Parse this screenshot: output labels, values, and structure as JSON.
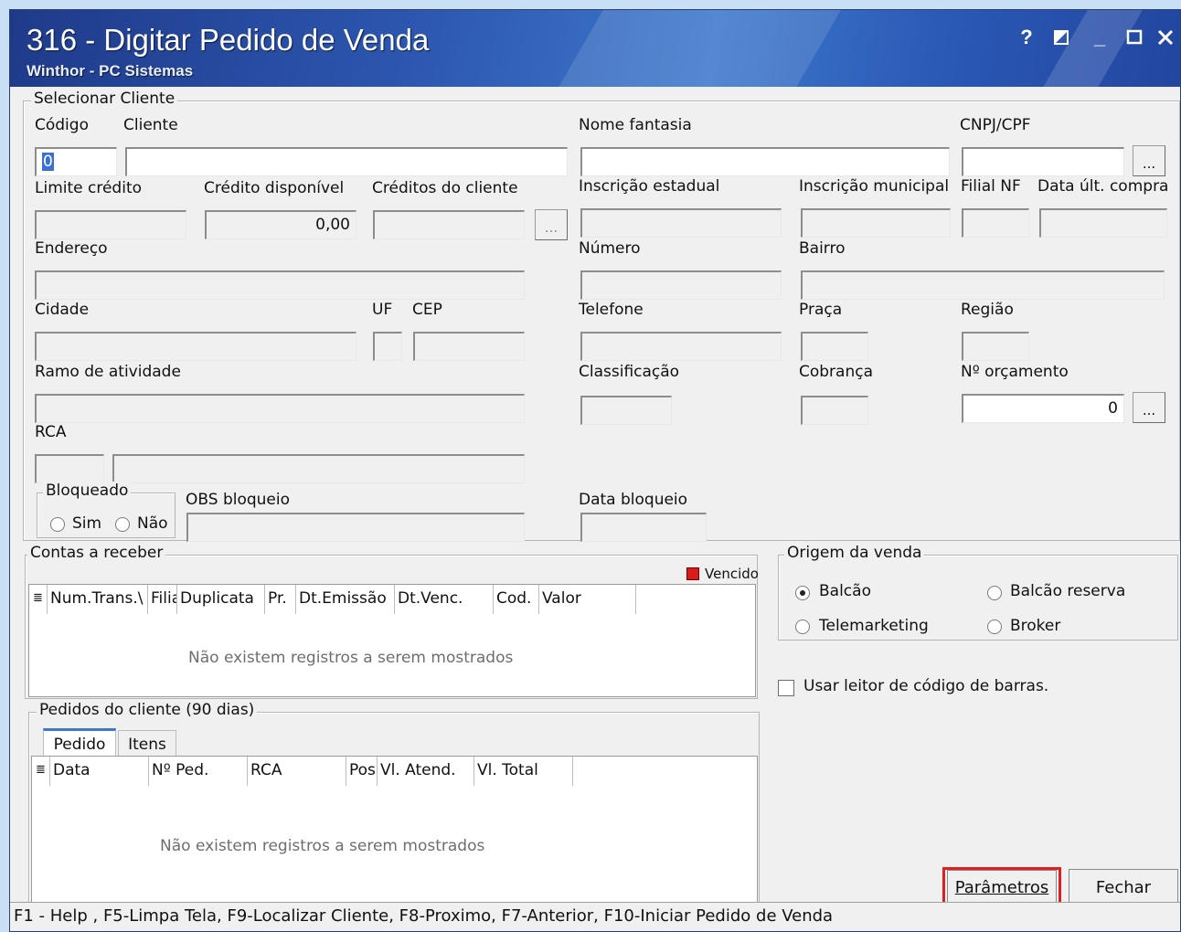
{
  "window": {
    "title": "316 - Digitar Pedido de Venda",
    "subtitle": "Winthor - PC Sistemas",
    "controls": {
      "help": "?",
      "restore": "◩",
      "minimize": "_",
      "maximize": "□",
      "close": "✕"
    }
  },
  "cliente": {
    "group_title": "Selecionar Cliente",
    "codigo_label": "Código",
    "codigo_value": "0",
    "cliente_label": "Cliente",
    "nome_fantasia_label": "Nome fantasia",
    "cnpj_label": "CNPJ/CPF",
    "limite_label": "Limite crédito",
    "credito_disp_label": "Crédito disponível",
    "credito_disp_value": "0,00",
    "creditos_cliente_label": "Créditos do cliente",
    "insc_estadual_label": "Inscrição estadual",
    "insc_municipal_label": "Inscrição municipal",
    "filial_nf_label": "Filial NF",
    "data_ult_compra_label": "Data últ. compra",
    "endereco_label": "Endereço",
    "numero_label": "Número",
    "bairro_label": "Bairro",
    "cidade_label": "Cidade",
    "uf_label": "UF",
    "cep_label": "CEP",
    "telefone_label": "Telefone",
    "praca_label": "Praça",
    "regiao_label": "Região",
    "ramo_label": "Ramo de atividade",
    "classificacao_label": "Classificação",
    "cobranca_label": "Cobrança",
    "orcamento_label": "Nº orçamento",
    "orcamento_value": "0",
    "rca_label": "RCA",
    "bloqueado_title": "Bloqueado",
    "sim_label": "Sim",
    "nao_label": "Não",
    "obs_bloqueio_label": "OBS bloqueio",
    "data_bloqueio_label": "Data bloqueio",
    "browse_label": "..."
  },
  "contas": {
    "title": "Contas a receber",
    "vencido_label": "Vencido",
    "vencido_color": "#d81c1c",
    "columns": [
      "Num.Trans.\\",
      "Filia",
      "Duplicata",
      "Pr.",
      "Dt.Emissão",
      "Dt.Venc.",
      "Cod.",
      "Valor"
    ],
    "empty": "Não existem registros a serem mostrados"
  },
  "pedidos": {
    "title": "Pedidos do cliente (90 dias)",
    "tabs": [
      "Pedido",
      "Itens"
    ],
    "columns": [
      "Data",
      "Nº Ped.",
      "RCA",
      "Pos",
      "Vl. Atend.",
      "Vl. Total"
    ],
    "empty": "Não existem registros a serem mostrados"
  },
  "origem": {
    "title": "Origem da venda",
    "options": [
      "Balcão",
      "Balcão reserva",
      "Telemarketing",
      "Broker"
    ],
    "selected": "Balcão"
  },
  "barcode_label": "Usar leitor de código de barras.",
  "buttons": {
    "parametros": "Parâmetros",
    "fechar": "Fechar",
    "highlight_color": "#e02020"
  },
  "status_text": "F1 - Help , F5-Limpa Tela, F9-Localizar Cliente, F8-Proximo, F7-Anterior, F10-Iniciar Pedido de Venda"
}
